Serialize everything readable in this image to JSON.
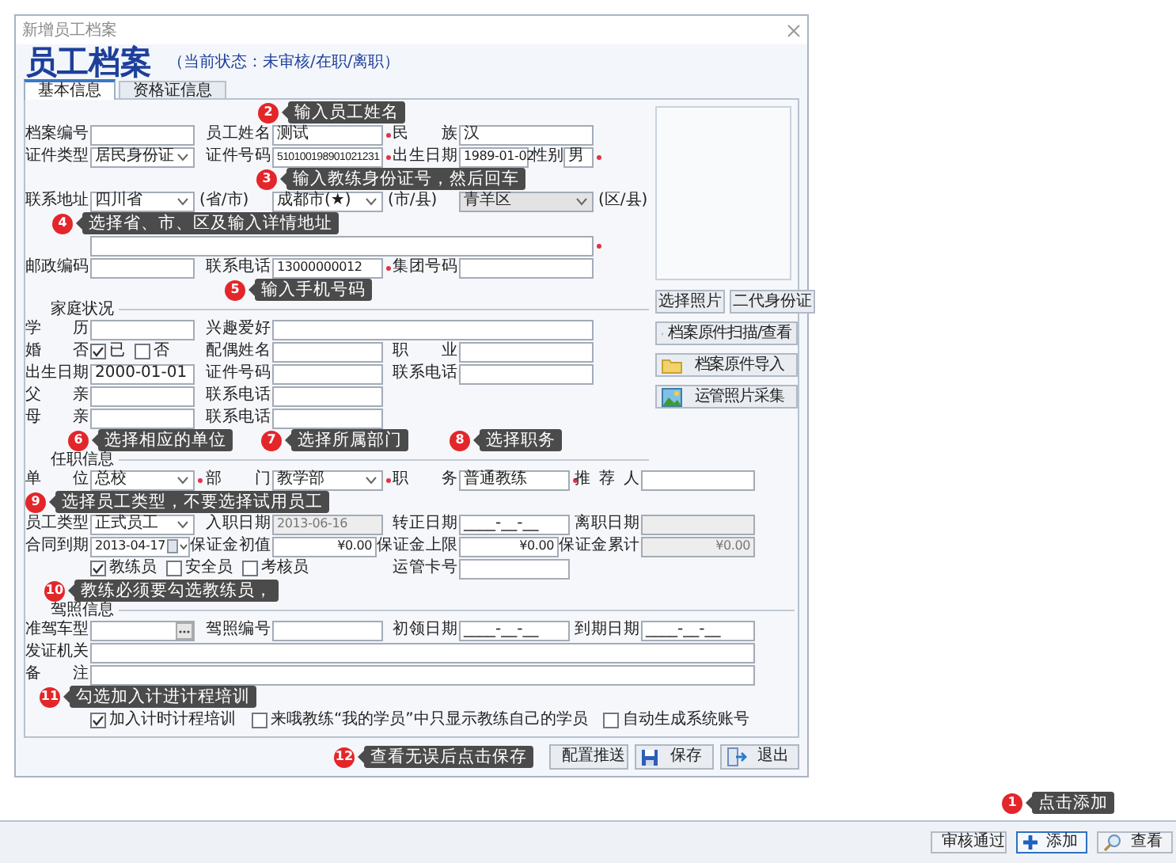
{
  "window": {
    "title": "新增员工档案"
  },
  "header": {
    "title": "员工档案",
    "status": "（当前状态：未审核/在职/离职）"
  },
  "tabs": [
    {
      "label": "基本信息",
      "selected": true
    },
    {
      "label": "资格证信息",
      "selected": false
    }
  ],
  "form": {
    "top_rows": [
      {
        "kind": "fields",
        "fields": [
          {
            "label": "档案编号",
            "kind": "text"
          },
          {
            "label": "员工姓名",
            "kind": "text",
            "value": "测试",
            "required": true
          },
          {
            "label": "民族",
            "kind": "text",
            "value": "汉"
          }
        ]
      },
      {
        "kind": "fields",
        "fields": [
          {
            "label": "证件类型",
            "kind": "select",
            "value": "居民身份证"
          },
          {
            "label": "证件号码",
            "kind": "text",
            "value": "510100198901021231",
            "required": true
          },
          {
            "label": "出生日期",
            "kind": "text",
            "value": "1989-01-02"
          },
          {
            "label": "性别",
            "kind": "text",
            "value": "男",
            "required": true
          }
        ]
      },
      {
        "kind": "fields",
        "fields": [
          {
            "label": "联系地址",
            "kind": "select",
            "value": "四川省",
            "suffix": "(省/市)"
          },
          {
            "kind": "select",
            "value": "成都市(★)",
            "suffix": "(市/县)"
          },
          {
            "kind": "select",
            "value": "青羊区",
            "disabled": true,
            "suffix": "(区/县)"
          }
        ]
      },
      {
        "kind": "fields",
        "fields": [
          {
            "kind": "text",
            "required": true
          }
        ]
      },
      {
        "kind": "fields",
        "fields": [
          {
            "label": "邮政编码",
            "kind": "text"
          },
          {
            "label": "联系电话",
            "kind": "text",
            "value": "13000000012",
            "required": true
          },
          {
            "label": "集团号码",
            "kind": "text"
          }
        ]
      },
      {
        "kind": "section",
        "title": "家庭状况"
      },
      {
        "kind": "fields",
        "fields": [
          {
            "label": "学历",
            "kind": "text"
          },
          {
            "label": "兴趣爱好",
            "kind": "text"
          }
        ]
      },
      {
        "kind": "fields",
        "fields": [
          {
            "label": "婚否",
            "kind": "checks",
            "options": [
              {
                "label": "已",
                "checked": true
              },
              {
                "label": "否",
                "checked": false
              }
            ]
          },
          {
            "label": "配偶姓名",
            "kind": "text"
          },
          {
            "label": "职业",
            "kind": "text"
          }
        ]
      },
      {
        "kind": "fields",
        "fields": [
          {
            "label": "出生日期",
            "kind": "text",
            "value": "2000-01-01"
          },
          {
            "label": "证件号码",
            "kind": "text"
          },
          {
            "label": "联系电话",
            "kind": "text"
          }
        ]
      },
      {
        "kind": "fields",
        "fields": [
          {
            "label": "父亲",
            "kind": "text"
          },
          {
            "label": "联系电话",
            "kind": "text"
          }
        ]
      },
      {
        "kind": "fields",
        "fields": [
          {
            "label": "母亲",
            "kind": "text"
          },
          {
            "label": "联系电话",
            "kind": "text"
          }
        ]
      },
      {
        "kind": "section",
        "title": "任职信息"
      }
    ],
    "photo_panel": {
      "buttons": [
        {
          "label": "选择照片",
          "kind": "plain"
        },
        {
          "label": "二代身份证",
          "kind": "plain"
        },
        {
          "label": "档案原件扫描/查看",
          "kind": "scan"
        },
        {
          "label": "档案原件导入",
          "kind": "import"
        },
        {
          "label": "运管照片采集",
          "kind": "capture"
        }
      ]
    },
    "bottom_rows": [
      {
        "kind": "fields",
        "fields": [
          {
            "label": "单位",
            "kind": "select",
            "value": "总校",
            "required": true
          },
          {
            "label": "部门",
            "kind": "select",
            "value": "教学部",
            "required": true
          },
          {
            "label": "职务",
            "kind": "text",
            "value": "普通教练",
            "required": true
          },
          {
            "label": "推荐人",
            "kind": "text"
          }
        ]
      },
      {
        "kind": "fields",
        "fields": [
          {
            "label": "员工类型",
            "kind": "select",
            "value": "正式员工"
          },
          {
            "label": "入职日期",
            "kind": "text",
            "value": "2013-06-16",
            "disabled": true
          },
          {
            "label": "转正日期",
            "kind": "text",
            "value": "____-__-__"
          },
          {
            "label": "离职日期",
            "kind": "text",
            "disabled": true
          }
        ]
      },
      {
        "kind": "fields",
        "fields": [
          {
            "label": "合同到期",
            "kind": "date",
            "value": "2013-04-17"
          },
          {
            "label": "保证金初值",
            "kind": "money",
            "value": "¥0.00"
          },
          {
            "label": "保证金上限",
            "kind": "money",
            "value": "¥0.00"
          },
          {
            "label": "保证金累计",
            "kind": "money",
            "value": "¥0.00",
            "disabled": true
          }
        ]
      },
      {
        "kind": "fields",
        "fields": [
          {
            "kind": "checks",
            "options": [
              {
                "label": "教练员",
                "checked": true
              },
              {
                "label": "安全员",
                "checked": false
              },
              {
                "label": "考核员",
                "checked": false
              }
            ]
          },
          {
            "label": "运管卡号",
            "kind": "text"
          }
        ]
      },
      {
        "kind": "section",
        "title": "驾照信息"
      },
      {
        "kind": "fields",
        "fields": [
          {
            "label": "准驾车型",
            "kind": "picker"
          },
          {
            "label": "驾照编号",
            "kind": "text"
          },
          {
            "label": "初领日期",
            "kind": "text",
            "value": "____-__-__"
          },
          {
            "label": "到期日期",
            "kind": "text",
            "value": "____-__-__"
          }
        ]
      },
      {
        "kind": "fields",
        "fields": [
          {
            "label": "发证机关",
            "kind": "text"
          }
        ]
      },
      {
        "kind": "fields",
        "fields": [
          {
            "label": "备注",
            "kind": "text"
          }
        ]
      },
      {
        "kind": "fields",
        "fields": [
          {
            "kind": "checks",
            "options": [
              {
                "label": "加入计时计程培训",
                "checked": true
              },
              {
                "label": "来哦教练“我的学员”中只显示教练自己的学员",
                "checked": false
              },
              {
                "label": "自动生成系统账号",
                "checked": false
              }
            ]
          }
        ]
      }
    ]
  },
  "dialog_buttons": [
    {
      "label": "配置推送",
      "kind": "push"
    },
    {
      "label": "保存",
      "kind": "save"
    },
    {
      "label": "退出",
      "kind": "exit"
    }
  ],
  "toolbar_buttons": [
    {
      "label": "审核通过",
      "kind": "approve",
      "focused": false
    },
    {
      "label": "添加",
      "kind": "add",
      "focused": true
    },
    {
      "label": "查看",
      "kind": "view",
      "focused": false
    }
  ],
  "callouts": [
    {
      "number": "1",
      "text": "点击添加"
    },
    {
      "number": "2",
      "text": "输入员工姓名"
    },
    {
      "number": "3",
      "text": "输入教练身份证号，然后回车"
    },
    {
      "number": "4",
      "text": "选择省、市、区及输入详情地址"
    },
    {
      "number": "5",
      "text": "输入手机号码"
    },
    {
      "number": "6",
      "text": "选择相应的单位"
    },
    {
      "number": "7",
      "text": "选择所属部门"
    },
    {
      "number": "8",
      "text": "选择职务"
    },
    {
      "number": "9",
      "text": "选择员工类型，不要选择试用员工"
    },
    {
      "number": "10",
      "text": "教练必须要勾选教练员，"
    },
    {
      "number": "11",
      "text": "勾选加入计进计程培训"
    },
    {
      "number": "12",
      "text": "查看无误后点击保存"
    }
  ]
}
